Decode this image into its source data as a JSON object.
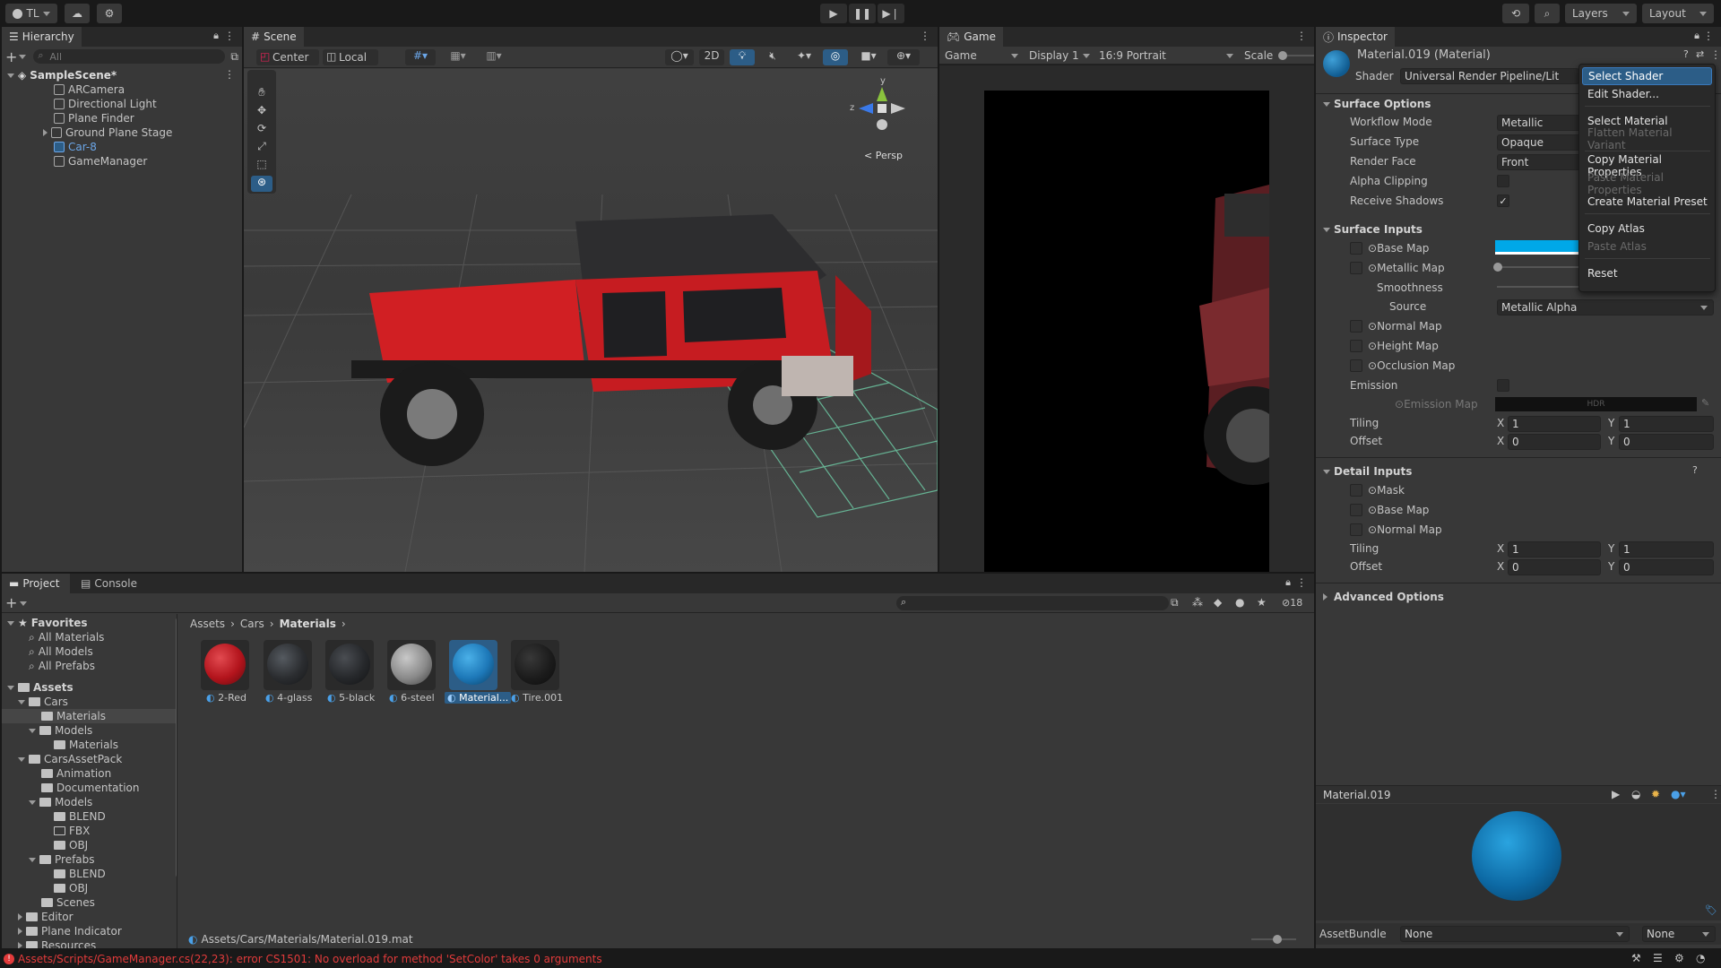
{
  "toolbar": {
    "account": "TL",
    "layers": "Layers",
    "layout": "Layout"
  },
  "hierarchy": {
    "tab": "Hierarchy",
    "search_placeholder": "All",
    "scene": "SampleScene*",
    "items": [
      "ARCamera",
      "Directional Light",
      "Plane Finder",
      "Ground Plane Stage",
      "Car-8",
      "GameManager"
    ]
  },
  "scene": {
    "tab": "Scene",
    "pivot": "Center",
    "space": "Local",
    "mode_2d": "2D",
    "persp": "Persp",
    "gizmo_y": "y",
    "gizmo_z": "z"
  },
  "game": {
    "tab": "Game",
    "view": "Game",
    "display": "Display 1",
    "aspect": "16:9 Portrait",
    "scale": "Scale"
  },
  "inspector": {
    "tab": "Inspector",
    "title": "Material.019 (Material)",
    "shader_label": "Shader",
    "shader_value": "Universal Render Pipeline/Lit",
    "surface_options": {
      "header": "Surface Options",
      "rows": [
        {
          "label": "Workflow Mode",
          "value": "Metallic"
        },
        {
          "label": "Surface Type",
          "value": "Opaque"
        },
        {
          "label": "Render Face",
          "value": "Front"
        }
      ],
      "alpha_clipping": "Alpha Clipping",
      "receive_shadows": "Receive Shadows"
    },
    "surface_inputs": {
      "header": "Surface Inputs",
      "base_map": "Base Map",
      "metallic_map": "Metallic Map",
      "smoothness": "Smoothness",
      "source": "Source",
      "source_value": "Metallic Alpha",
      "normal_map": "Normal Map",
      "height_map": "Height Map",
      "occlusion_map": "Occlusion Map",
      "emission": "Emission",
      "emission_map": "Emission Map",
      "hdr": "HDR",
      "tiling": "Tiling",
      "offset": "Offset",
      "tiling_x": "1",
      "tiling_y": "1",
      "offset_x": "0",
      "offset_y": "0"
    },
    "detail_inputs": {
      "header": "Detail Inputs",
      "mask": "Mask",
      "base_map": "Base Map",
      "normal_map": "Normal Map",
      "tiling": "Tiling",
      "offset": "Offset",
      "tiling_x": "1",
      "tiling_y": "1",
      "offset_x": "0",
      "offset_y": "0"
    },
    "advanced_options": "Advanced Options",
    "preview_title": "Material.019",
    "assetbundle_label": "AssetBundle",
    "assetbundle_value": "None",
    "assetbundle_variant": "None",
    "axis_x": "X",
    "axis_y": "Y"
  },
  "context_menu": {
    "items": [
      {
        "label": "Select Shader",
        "state": "selected"
      },
      {
        "label": "Edit Shader...",
        "state": "enabled"
      },
      {
        "label": "Select Material",
        "state": "enabled"
      },
      {
        "label": "Flatten Material Variant",
        "state": "disabled"
      },
      {
        "label": "Copy Material Properties",
        "state": "enabled"
      },
      {
        "label": "Paste Material Properties",
        "state": "disabled"
      },
      {
        "label": "Create Material Preset",
        "state": "enabled"
      },
      {
        "label": "Copy Atlas",
        "state": "enabled"
      },
      {
        "label": "Paste Atlas",
        "state": "disabled"
      },
      {
        "label": "Reset",
        "state": "enabled"
      }
    ]
  },
  "project": {
    "tab_project": "Project",
    "tab_console": "Console",
    "hidden_count": "18",
    "breadcrumb": [
      "Assets",
      "Cars",
      "Materials"
    ],
    "favorites_header": "Favorites",
    "favorites": [
      "All Materials",
      "All Models",
      "All Prefabs"
    ],
    "assets_header": "Assets",
    "tree": [
      "Cars",
      "Materials",
      "Models",
      "Materials",
      "CarsAssetPack",
      "Animation",
      "Documentation",
      "Models",
      "BLEND",
      "FBX",
      "OBJ",
      "Prefabs",
      "BLEND",
      "OBJ",
      "Scenes",
      "Editor",
      "Plane Indicator",
      "Resources"
    ],
    "materials": [
      {
        "name": "2-Red",
        "color": "#b3141c"
      },
      {
        "name": "4-glass",
        "color": "#2b2d30"
      },
      {
        "name": "5-black",
        "color": "#26282b"
      },
      {
        "name": "6-steel",
        "color": "#8a8a8a"
      },
      {
        "name": "Material...",
        "color": "#1d78b8"
      },
      {
        "name": "Tire.001",
        "color": "#1c1c1c"
      }
    ],
    "path": "Assets/Cars/Materials/Material.019.mat"
  },
  "status": {
    "error": "Assets/Scripts/GameManager.cs(22,23): error CS1501: No overload for method 'SetColor' takes 0 arguments",
    "error_color": "#e23b3b"
  },
  "colors": {
    "accent": "#3a79bb",
    "selected_row": "#2c5d87",
    "base_map_swatch": "#00a8e8"
  }
}
